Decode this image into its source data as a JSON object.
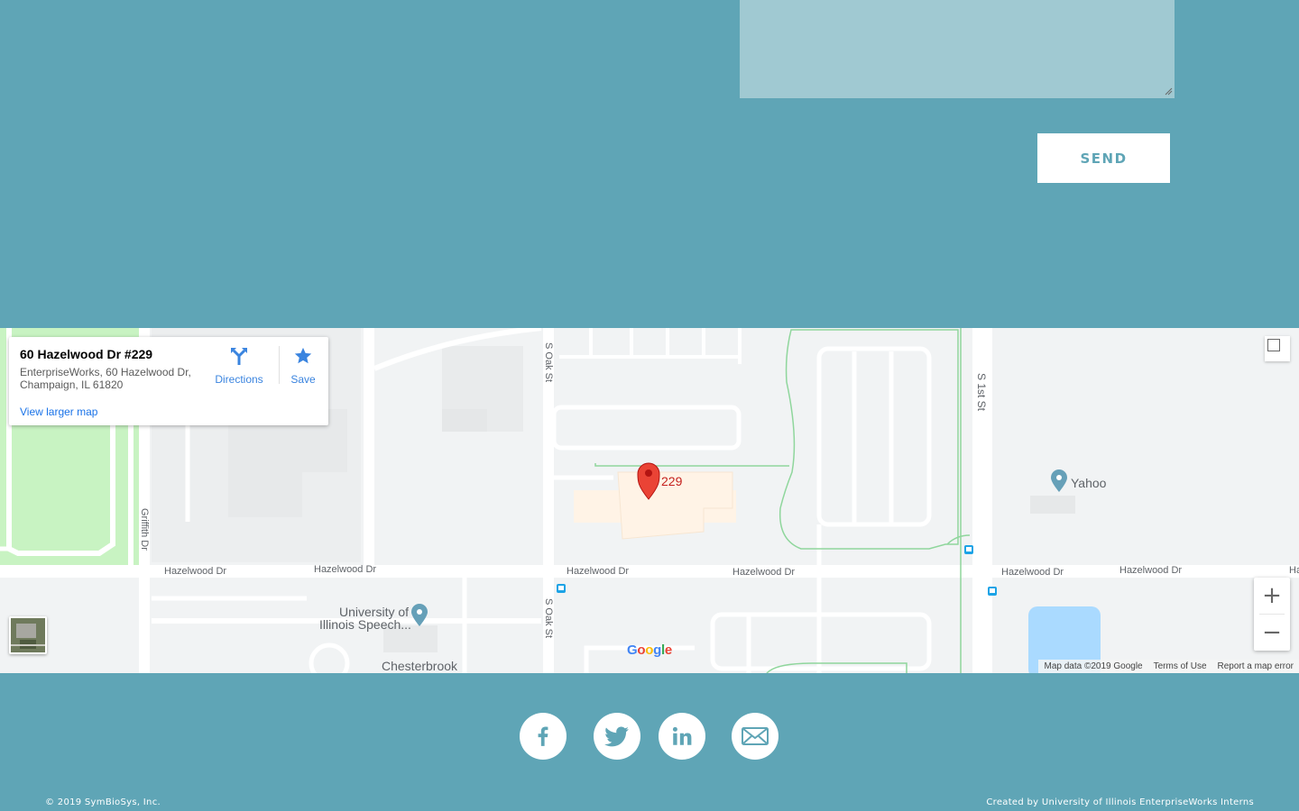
{
  "contact": {
    "message_value": "",
    "send_label": "SEND"
  },
  "map": {
    "info_card": {
      "place_name": "60 Hazelwood Dr #229",
      "address": "EnterpriseWorks, 60 Hazelwood Dr, Champaign, IL 61820",
      "directions_label": "Directions",
      "save_label": "Save",
      "view_larger_label": "View larger map"
    },
    "marker_label": "229",
    "streets": {
      "s_oak_st": "S Oak St",
      "s_1st_st": "S 1st St",
      "griffith_dr": "Griffith Dr",
      "hazelwood_dr": "Hazelwood Dr",
      "hazelwood_partial": "Ha"
    },
    "pois": {
      "yahoo": "Yahoo",
      "university_line1": "University of",
      "university_line2": "Illinois Speech...",
      "chesterbrook": "Chesterbrook"
    },
    "google_logo": {
      "letters": [
        "G",
        "o",
        "o",
        "g",
        "l",
        "e"
      ],
      "colors": [
        "#4285f4",
        "#ea4335",
        "#fbbc05",
        "#4285f4",
        "#34a853",
        "#ea4335"
      ]
    },
    "attribution": {
      "map_data": "Map data ©2019 Google",
      "terms": "Terms of Use",
      "report": "Report a map error"
    },
    "zoom_in_symbol": "+",
    "zoom_out_symbol": "−",
    "colors": {
      "marker_red": "#ea4335",
      "park_green": "#c8f3c2",
      "building": "#fff3e6",
      "water": "#aadaff",
      "transit_blue": "#1ca3e6"
    }
  },
  "footer": {
    "social_icons": [
      "facebook-icon",
      "twitter-icon",
      "linkedin-icon",
      "email-icon"
    ],
    "copyright": "© 2019 SymBioSys, Inc.",
    "credits": "Created by University of Illinois EnterpriseWorks Interns"
  },
  "colors": {
    "background_teal": "#5fa5b6",
    "textarea_bg": "#a0c9d2",
    "link_blue": "#1a73e8"
  }
}
